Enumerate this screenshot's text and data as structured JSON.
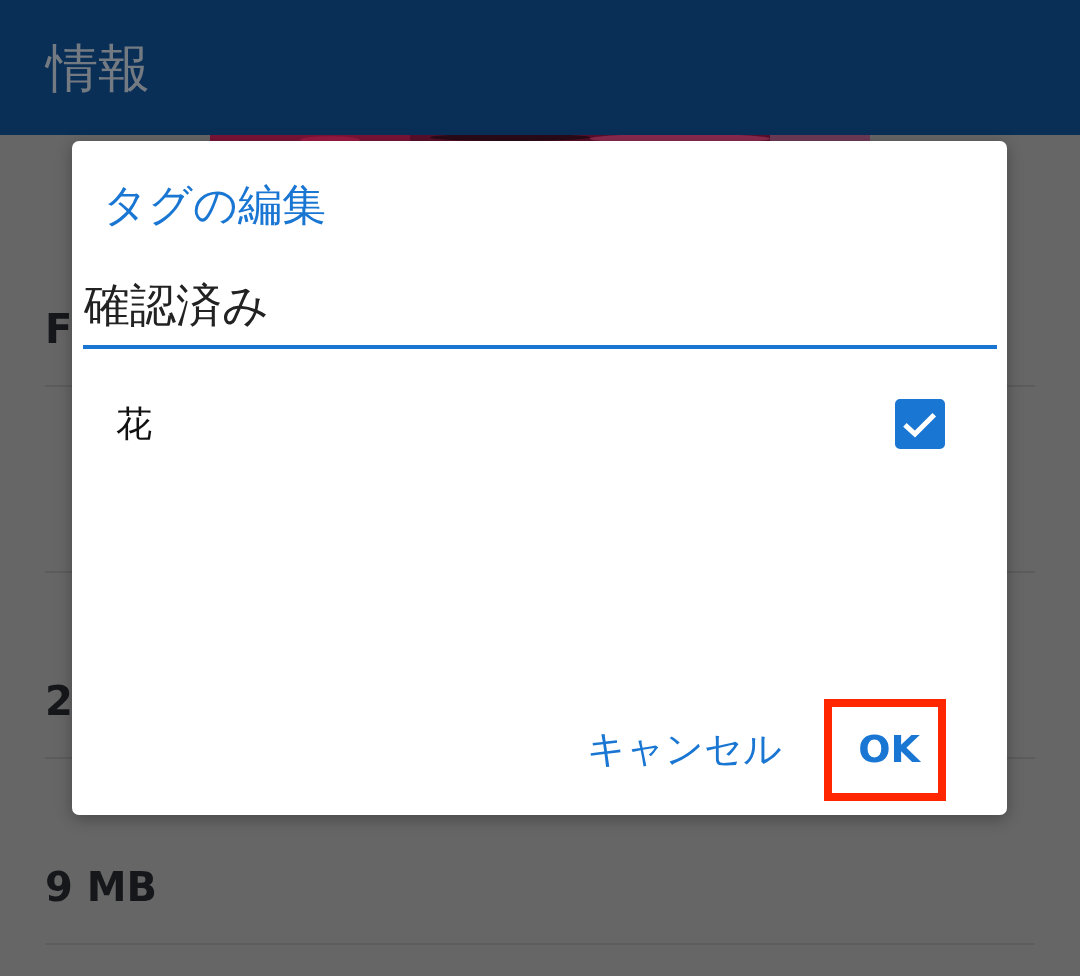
{
  "app_bar": {
    "title": "情報"
  },
  "background": {
    "sections": [
      {
        "kind": "value",
        "value": "F"
      },
      {
        "kind": "covered"
      },
      {
        "kind": "value",
        "value": "2"
      },
      {
        "kind": "value",
        "value": "9 MB"
      },
      {
        "kind": "covered"
      }
    ]
  },
  "dialog": {
    "title": "タグの編集",
    "input": {
      "value": "確認済み",
      "focused": true
    },
    "tags": [
      {
        "name": "花",
        "checked": true
      }
    ],
    "buttons": [
      {
        "label": "キャンセル",
        "kind": "text",
        "highlighted": false
      },
      {
        "label": "OK",
        "kind": "primary",
        "highlighted": true
      }
    ]
  }
}
